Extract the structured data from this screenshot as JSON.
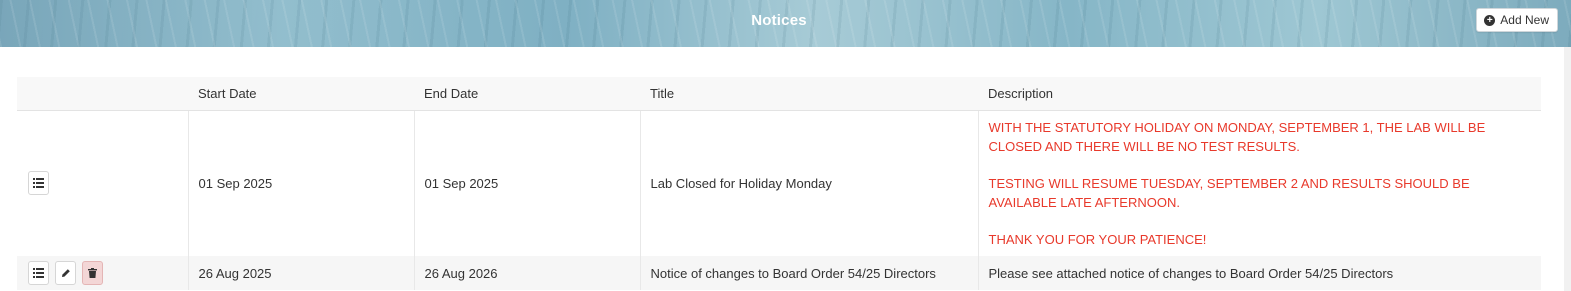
{
  "header": {
    "title": "Notices",
    "add_new_label": "Add New"
  },
  "table": {
    "columns": [
      "",
      "Start Date",
      "End Date",
      "Title",
      "Description"
    ],
    "rows": [
      {
        "start_date": "01 Sep 2025",
        "end_date": "01 Sep 2025",
        "title": "Lab Closed for Holiday Monday",
        "description_paragraphs": [
          "WITH THE STATUTORY HOLIDAY ON MONDAY, SEPTEMBER 1, THE LAB WILL BE CLOSED AND THERE WILL BE NO TEST RESULTS.",
          "TESTING WILL RESUME TUESDAY, SEPTEMBER 2 AND RESULTS SHOULD BE AVAILABLE LATE AFTERNOON.",
          "THANK YOU FOR YOUR PATIENCE!"
        ],
        "description_color": "#e8392b",
        "actions": [
          "list-icon"
        ]
      },
      {
        "start_date": "26 Aug 2025",
        "end_date": "26 Aug 2026",
        "title": "Notice of changes to Board Order 54/25 Directors",
        "description": "Please see attached notice of changes to Board Order 54/25 Directors",
        "actions": [
          "list-icon",
          "pencil-icon",
          "trash-icon"
        ]
      }
    ]
  }
}
